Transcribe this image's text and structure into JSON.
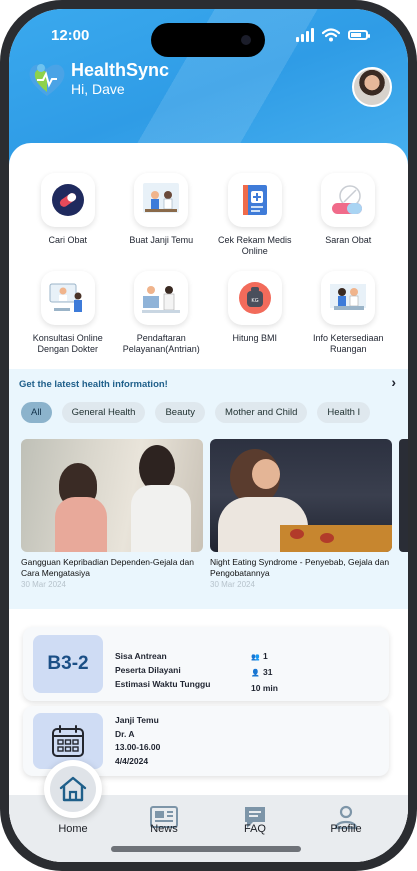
{
  "status": {
    "time": "12:00"
  },
  "header": {
    "app_name": "HealthSync",
    "greeting": "Hi, Dave",
    "brand_color": "#2f9ce6"
  },
  "menu": [
    {
      "label": "Cari Obat",
      "icon": "pill-icon"
    },
    {
      "label": "Buat Janji Temu",
      "icon": "doctor-appointment-icon"
    },
    {
      "label": "Cek Rekam Medis Online",
      "icon": "medical-record-icon"
    },
    {
      "label": "Saran Obat",
      "icon": "medicine-capsule-icon"
    },
    {
      "label": "Konsultasi Online Dengan Dokter",
      "icon": "online-consultation-icon"
    },
    {
      "label": "Pendaftaran Pelayanan(Antrian)",
      "icon": "registration-queue-icon"
    },
    {
      "label": "Hitung BMI",
      "icon": "weight-scale-icon"
    },
    {
      "label": "Info Ketersediaan Ruangan",
      "icon": "hospital-room-icon"
    }
  ],
  "health_info": {
    "title": "Get the latest health information!",
    "chips": [
      "All",
      "General Health",
      "Beauty",
      "Mother and Child",
      "Health I"
    ],
    "articles": [
      {
        "title": "Gangguan Kepribadian Dependen-Gejala dan Cara Mengatasiya",
        "date": "30 Mar 2024"
      },
      {
        "title": "Night Eating Syndrome - Penyebab, Gejala dan Pengobatannya",
        "date": "30 Mar 2024"
      }
    ]
  },
  "queue": {
    "code": "B3-2",
    "labels": [
      "Sisa Antrean",
      "Peserta Dilayani",
      "Estimasi Waktu Tunggu"
    ],
    "values": [
      "1",
      "31",
      "10 min"
    ]
  },
  "appointment": {
    "title": "Janji Temu",
    "doctor": "Dr. A",
    "time": "13.00-16.00",
    "date": "4/4/2024"
  },
  "nav": {
    "home": "Home",
    "news": "News",
    "faq": "FAQ",
    "profile": "Profile"
  }
}
